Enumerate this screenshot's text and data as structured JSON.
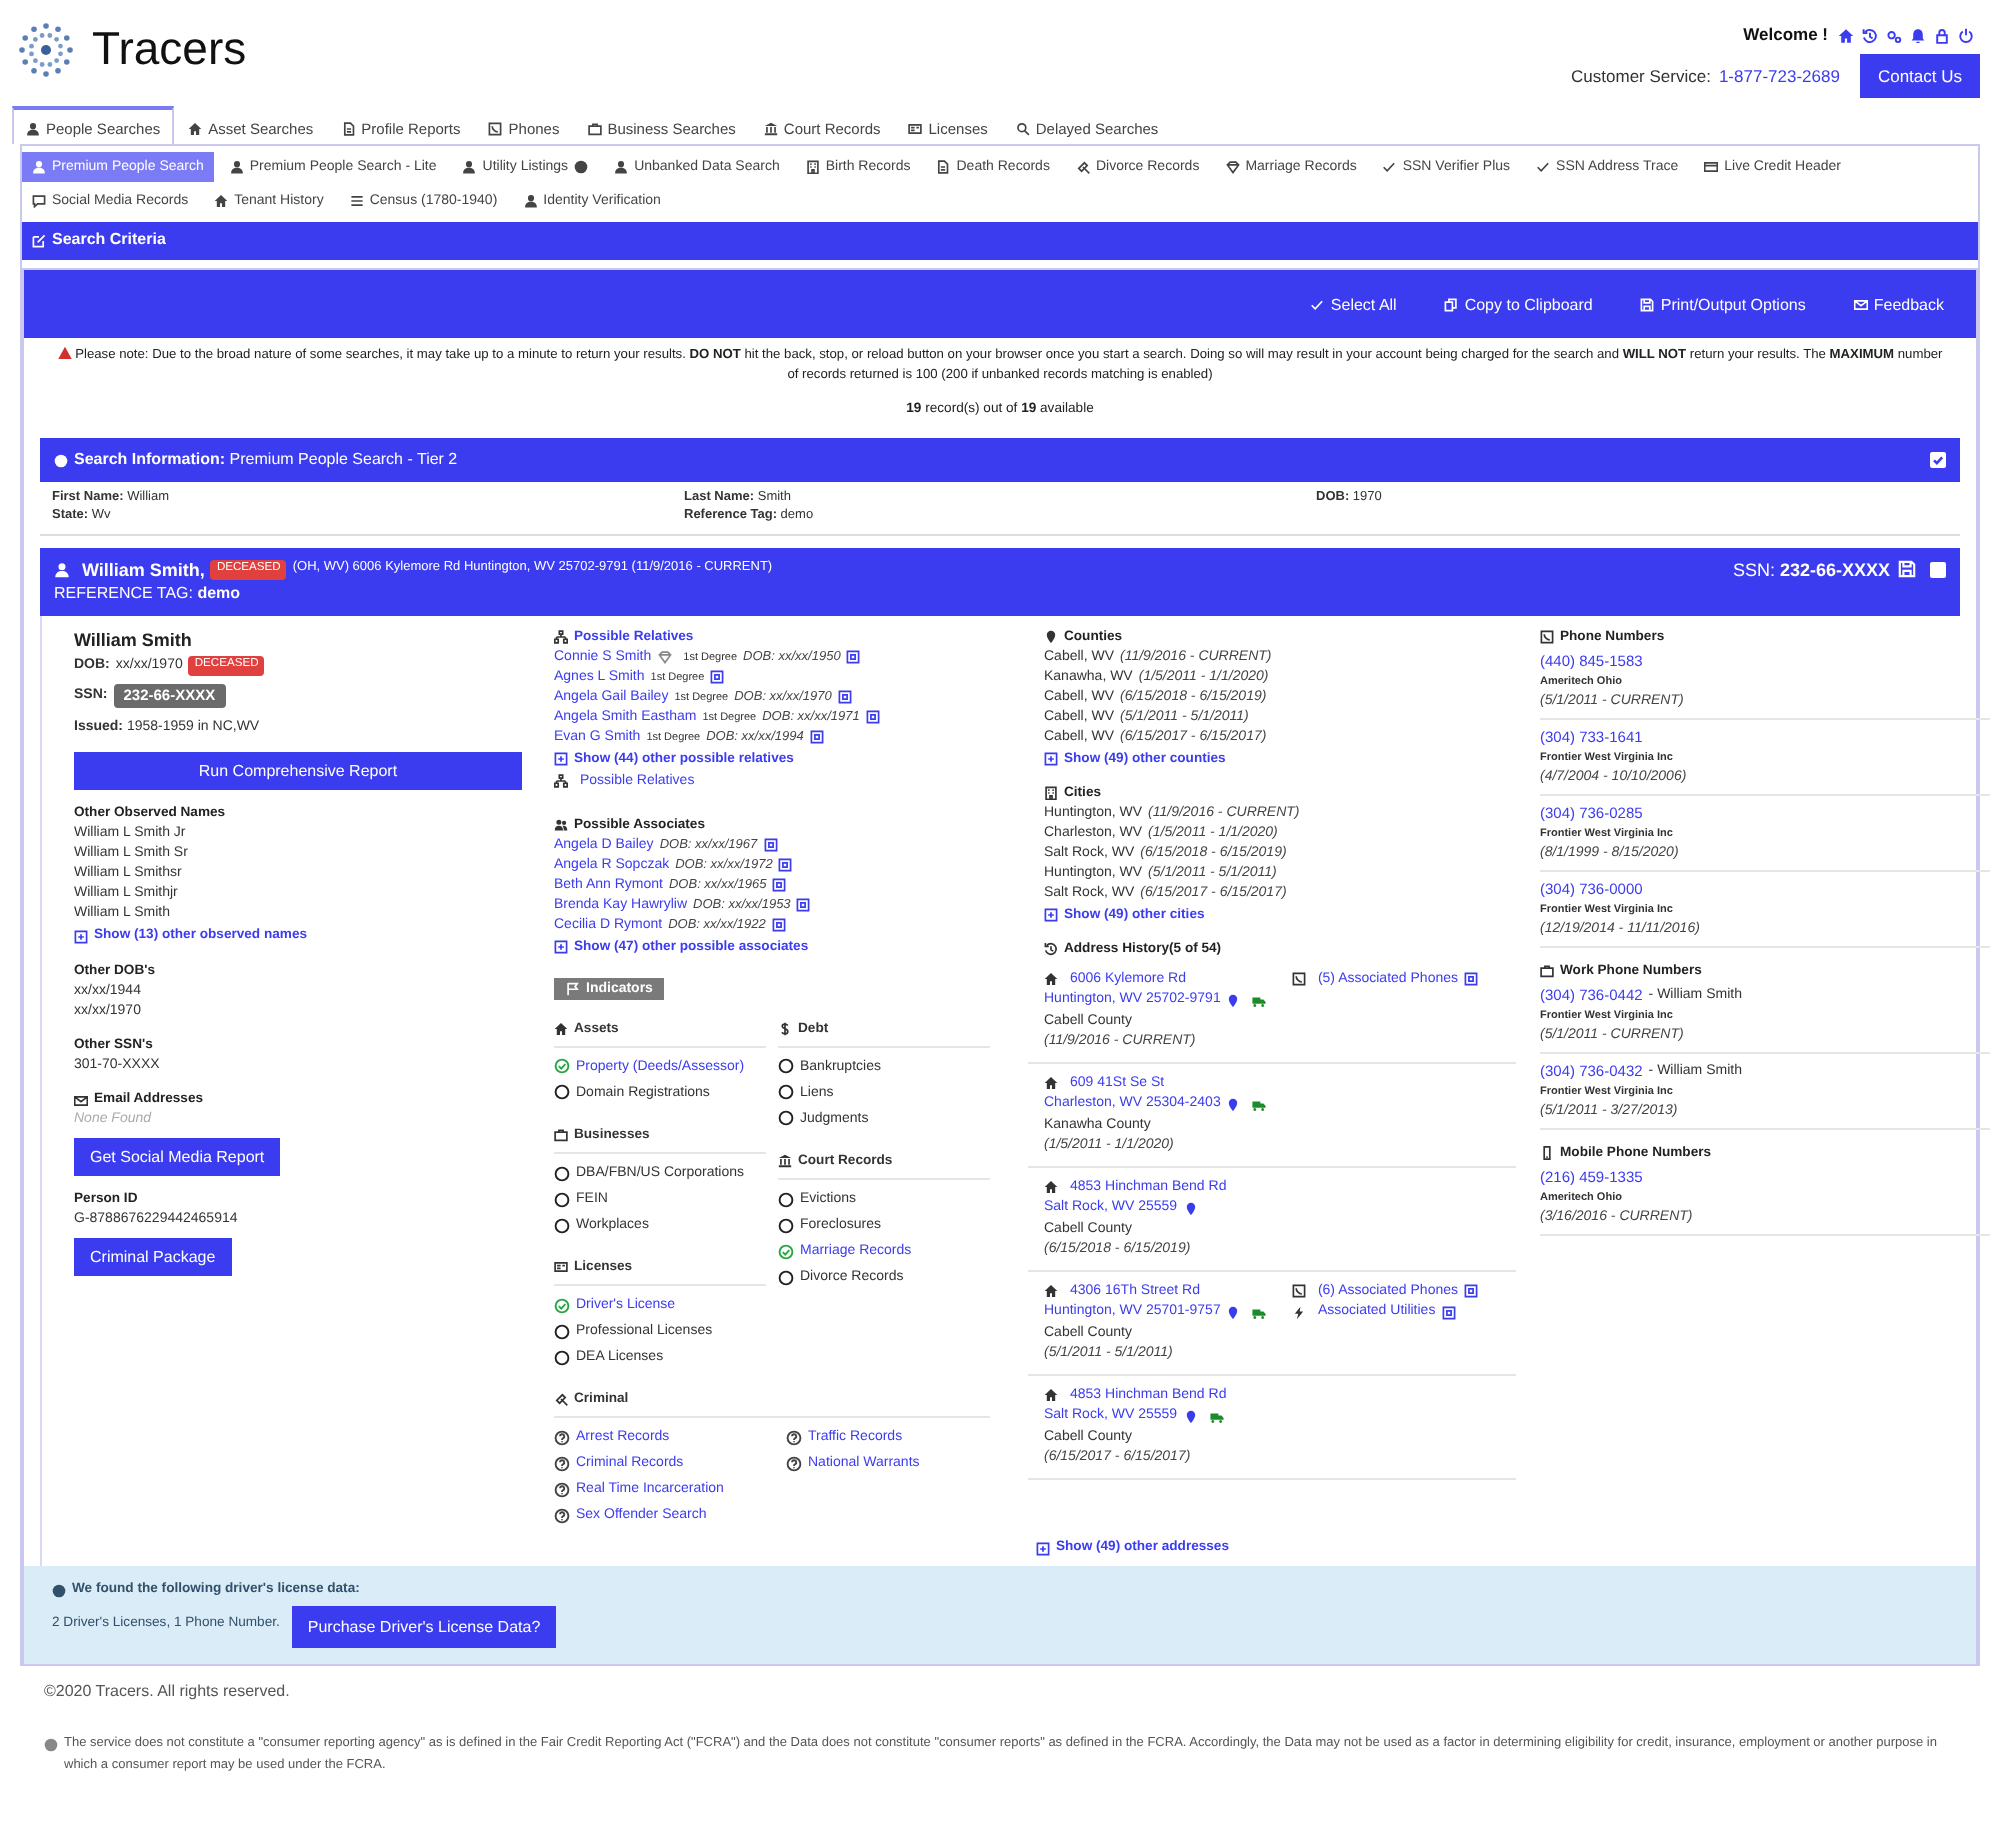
{
  "header": {
    "logo": "Tracers",
    "welcome": "Welcome !",
    "customer_service_label": "Customer Service:",
    "phone": "1-877-723-2689",
    "contact_button": "Contact Us"
  },
  "main_tabs": [
    {
      "label": "People Searches",
      "selected": true
    },
    {
      "label": "Asset Searches",
      "selected": false
    },
    {
      "label": "Profile Reports",
      "selected": false
    },
    {
      "label": "Phones",
      "selected": false
    },
    {
      "label": "Business Searches",
      "selected": false
    },
    {
      "label": "Court Records",
      "selected": false
    },
    {
      "label": "Licenses",
      "selected": false
    },
    {
      "label": "Delayed Searches",
      "selected": false
    }
  ],
  "sub_tabs": [
    {
      "label": "Premium People Search",
      "selected": true,
      "info_icon": false
    },
    {
      "label": "Premium People Search - Lite",
      "selected": false,
      "info_icon": false
    },
    {
      "label": "Utility Listings",
      "selected": false,
      "info_icon": true
    },
    {
      "label": "Unbanked Data Search",
      "selected": false,
      "info_icon": false
    },
    {
      "label": "Birth Records",
      "selected": false,
      "info_icon": false
    },
    {
      "label": "Death Records",
      "selected": false,
      "info_icon": false
    },
    {
      "label": "Divorce Records",
      "selected": false,
      "info_icon": false
    },
    {
      "label": "Marriage Records",
      "selected": false,
      "info_icon": false
    },
    {
      "label": "SSN Verifier Plus",
      "selected": false,
      "info_icon": false
    },
    {
      "label": "SSN Address Trace",
      "selected": false,
      "info_icon": false
    },
    {
      "label": "Live Credit Header",
      "selected": false,
      "info_icon": false
    },
    {
      "label": "Social Media Records",
      "selected": false,
      "info_icon": false
    },
    {
      "label": "Tenant History",
      "selected": false,
      "info_icon": false
    },
    {
      "label": "Census (1780-1940)",
      "selected": false,
      "info_icon": false
    },
    {
      "label": "Identity Verification",
      "selected": false,
      "info_icon": false
    }
  ],
  "search_criteria": {
    "title": "Search Criteria"
  },
  "toolbar": [
    "Select All",
    "Copy to Clipboard",
    "Print/Output Options",
    "Feedback"
  ],
  "notice": "Please note: Due to the broad nature of some searches, it may take up to a minute to return your results. **DO NOT** hit the back, stop, or reload button on your browser once you start a search. Doing so will may result in your account being charged for the search and **WILL NOT** return your results. The **MAXIMUM** number of records returned is 100 (200 if unbanked records matching is enabled)",
  "record_count": "**19** record(s) out of **19** available",
  "search_information": {
    "title": "**Search Information:** Premium People Search - Tier 2",
    "checked": true,
    "columns": [
      [
        {
          "label": "First Name:",
          "value": "William"
        },
        {
          "label": "State:",
          "value": "Wv"
        }
      ],
      [
        {
          "label": "Last Name:",
          "value": "Smith"
        },
        {
          "label": "Reference Tag:",
          "value": "demo"
        }
      ],
      [
        {
          "label": "DOB:",
          "value": "1970"
        }
      ]
    ]
  },
  "person_header": {
    "name": "William Smith,",
    "badge": "DECEASED",
    "details": "(OH, WV) 6006 Kylemore Rd Huntington, WV 25702-9791 (11/9/2016 - CURRENT)",
    "reference": "REFERENCE TAG: **demo**",
    "ssn": "SSN: **232-66-XXXX**",
    "checked": false
  },
  "person": {
    "name": "William Smith",
    "dob_label": "DOB:",
    "dob": "xx/xx/1970",
    "badge": "DECEASED",
    "ssn_label": "SSN:",
    "ssn": "232-66-XXXX",
    "issued": "**Issued:** 1958-1959 in NC,WV",
    "run_button": "Run Comprehensive Report",
    "other_names": {
      "title": "Other Observed Names",
      "items": [
        "William L Smith Jr",
        "William L Smith Sr",
        "William L Smithsr",
        "William L Smithjr",
        "William L Smith"
      ],
      "show_more": "Show (13) other observed names"
    },
    "other_dobs": {
      "title": "Other DOB's",
      "items": [
        "xx/xx/1944",
        "xx/xx/1970"
      ]
    },
    "other_ssns": {
      "title": "Other SSN's",
      "items": [
        "301-70-XXXX"
      ]
    },
    "email": {
      "title": "Email Addresses",
      "empty": "None Found"
    },
    "social_button": "Get Social Media Report",
    "person_id": {
      "title": "Person ID",
      "value": "G-8788676229442465914"
    },
    "criminal_button": "Criminal Package"
  },
  "relatives": {
    "title": "Possible Relatives",
    "items": [
      {
        "name": "Connie S Smith",
        "marked": true,
        "degree": "1st Degree",
        "dob": "DOB: xx/xx/1950"
      },
      {
        "name": "Agnes L Smith",
        "marked": false,
        "degree": "1st Degree"
      },
      {
        "name": "Angela Gail Bailey",
        "marked": false,
        "degree": "1st Degree",
        "dob": "DOB: xx/xx/1970"
      },
      {
        "name": "Angela Smith Eastham",
        "marked": false,
        "degree": "1st Degree",
        "dob": "DOB: xx/xx/1971"
      },
      {
        "name": "Evan G Smith",
        "marked": false,
        "degree": "1st Degree",
        "dob": "DOB: xx/xx/1994"
      }
    ],
    "show_more": "Show (44) other possible relatives",
    "link": "Possible Relatives"
  },
  "associates": {
    "title": "Possible Associates",
    "items": [
      {
        "name": "Angela D Bailey",
        "dob": "DOB: xx/xx/1967"
      },
      {
        "name": "Angela R Sopczak",
        "dob": "DOB: xx/xx/1972"
      },
      {
        "name": "Beth Ann Rymont",
        "dob": "DOB: xx/xx/1965"
      },
      {
        "name": "Brenda Kay Hawryliw",
        "dob": "DOB: xx/xx/1953"
      },
      {
        "name": "Cecilia D Rymont",
        "dob": "DOB: xx/xx/1922"
      }
    ],
    "show_more": "Show (47) other possible associates"
  },
  "indicators": {
    "label": "Indicators",
    "columns": [
      [
        {
          "title": "Assets",
          "items": [
            {
              "label": "Property (Deeds/Assessor)",
              "found": true
            },
            {
              "label": "Domain Registrations",
              "found": false
            }
          ]
        },
        {
          "title": "Businesses",
          "items": [
            {
              "label": "DBA/FBN/US Corporations",
              "found": false
            },
            {
              "label": "FEIN",
              "found": false
            },
            {
              "label": "Workplaces",
              "found": false
            }
          ]
        },
        {
          "title": "Licenses",
          "items": [
            {
              "label": "Driver's License",
              "found": true
            },
            {
              "label": "Professional Licenses",
              "found": false
            },
            {
              "label": "DEA Licenses",
              "found": false
            }
          ]
        }
      ],
      [
        {
          "title": "Debt",
          "items": [
            {
              "label": "Bankruptcies",
              "found": false
            },
            {
              "label": "Liens",
              "found": false
            },
            {
              "label": "Judgments",
              "found": false
            }
          ]
        },
        {
          "title": "Court Records",
          "items": [
            {
              "label": "Evictions",
              "found": false
            },
            {
              "label": "Foreclosures",
              "found": false
            },
            {
              "label": "Marriage Records",
              "found": true
            },
            {
              "label": "Divorce Records",
              "found": false
            }
          ]
        }
      ]
    ],
    "criminal": {
      "title": "Criminal",
      "items": [
        "Arrest Records",
        "Criminal Records",
        "Real Time Incarceration",
        "Sex Offender Search",
        "Traffic Records",
        "National Warrants"
      ]
    }
  },
  "counties": {
    "title": "Counties",
    "items": [
      {
        "place": "Cabell, WV",
        "dates": "(11/9/2016 - CURRENT)"
      },
      {
        "place": "Kanawha, WV",
        "dates": "(1/5/2011 - 1/1/2020)"
      },
      {
        "place": "Cabell, WV",
        "dates": "(6/15/2018 - 6/15/2019)"
      },
      {
        "place": "Cabell, WV",
        "dates": "(5/1/2011 - 5/1/2011)"
      },
      {
        "place": "Cabell, WV",
        "dates": "(6/15/2017 - 6/15/2017)"
      }
    ],
    "show_more": "Show (49) other counties"
  },
  "cities": {
    "title": "Cities",
    "items": [
      {
        "place": "Huntington, WV",
        "dates": "(11/9/2016 - CURRENT)"
      },
      {
        "place": "Charleston, WV",
        "dates": "(1/5/2011 - 1/1/2020)"
      },
      {
        "place": "Salt Rock, WV",
        "dates": "(6/15/2018 - 6/15/2019)"
      },
      {
        "place": "Huntington, WV",
        "dates": "(5/1/2011 - 5/1/2011)"
      },
      {
        "place": "Salt Rock, WV",
        "dates": "(6/15/2017 - 6/15/2017)"
      }
    ],
    "show_more": "Show (49) other cities"
  },
  "address_history": {
    "title": "Address History",
    "count": "(5 of 54)",
    "items": [
      {
        "street": "6006 Kylemore Rd",
        "city": "Huntington, WV 25702-9791",
        "pin": true,
        "truck": true,
        "county": "Cabell County",
        "dates": "(11/9/2016 - CURRENT)",
        "phones": "(5) Associated Phones"
      },
      {
        "street": "609 41St Se St",
        "city": "Charleston, WV 25304-2403",
        "pin": true,
        "truck": true,
        "county": "Kanawha County",
        "dates": "(1/5/2011 - 1/1/2020)"
      },
      {
        "street": "4853 Hinchman Bend Rd",
        "city": "Salt Rock, WV 25559",
        "pin": true,
        "truck": false,
        "county": "Cabell County",
        "dates": "(6/15/2018 - 6/15/2019)"
      },
      {
        "street": "4306 16Th Street Rd",
        "city": "Huntington, WV 25701-9757",
        "pin": true,
        "truck": true,
        "county": "Cabell County",
        "dates": "(5/1/2011 - 5/1/2011)",
        "phones": "(6) Associated Phones",
        "utilities": "Associated Utilities"
      },
      {
        "street": "4853 Hinchman Bend Rd",
        "city": "Salt Rock, WV 25559",
        "pin": true,
        "truck": true,
        "county": "Cabell County",
        "dates": "(6/15/2017 - 6/15/2017)"
      }
    ],
    "show_more": "Show (49) other addresses"
  },
  "phone_groups": [
    {
      "title": "Phone Numbers",
      "items": [
        {
          "number": "(440) 845-1583",
          "carrier": "Ameritech Ohio",
          "dates": "(5/1/2011 - CURRENT)"
        },
        {
          "number": "(304) 733-1641",
          "carrier": "Frontier West Virginia Inc",
          "dates": "(4/7/2004 - 10/10/2006)"
        },
        {
          "number": "(304) 736-0285",
          "carrier": "Frontier West Virginia Inc",
          "dates": "(8/1/1999 - 8/15/2020)"
        },
        {
          "number": "(304) 736-0000",
          "carrier": "Frontier West Virginia Inc",
          "dates": "(12/19/2014 - 11/11/2016)"
        }
      ]
    },
    {
      "title": "Work Phone Numbers",
      "items": [
        {
          "number": "(304) 736-0442",
          "owner": "- William Smith",
          "carrier": "Frontier West Virginia Inc",
          "dates": "(5/1/2011 - CURRENT)"
        },
        {
          "number": "(304) 736-0432",
          "owner": "- William Smith",
          "carrier": "Frontier West Virginia Inc",
          "dates": "(5/1/2011 - 3/27/2013)"
        }
      ]
    },
    {
      "title": "Mobile Phone Numbers",
      "items": [
        {
          "number": "(216) 459-1335",
          "carrier": "Ameritech Ohio",
          "dates": "(3/16/2016 - CURRENT)"
        }
      ]
    }
  ],
  "license_notice": {
    "title": "We found the following driver's license data:",
    "text": "2 Driver's Licenses, 1 Phone Number.",
    "button": "Purchase Driver's License Data?"
  },
  "footer": {
    "copyright": "©2020 Tracers. All rights reserved.",
    "disclaimer": "The service does not constitute a \"consumer reporting agency\" as is defined in the Fair Credit Reporting Act (\"FCRA\") and the Data does not constitute \"consumer reports\" as defined in the FCRA. Accordingly, the Data may not be used as a factor in determining eligibility for credit, insurance, employment or another purpose in which a consumer report may be used under the FCRA."
  }
}
